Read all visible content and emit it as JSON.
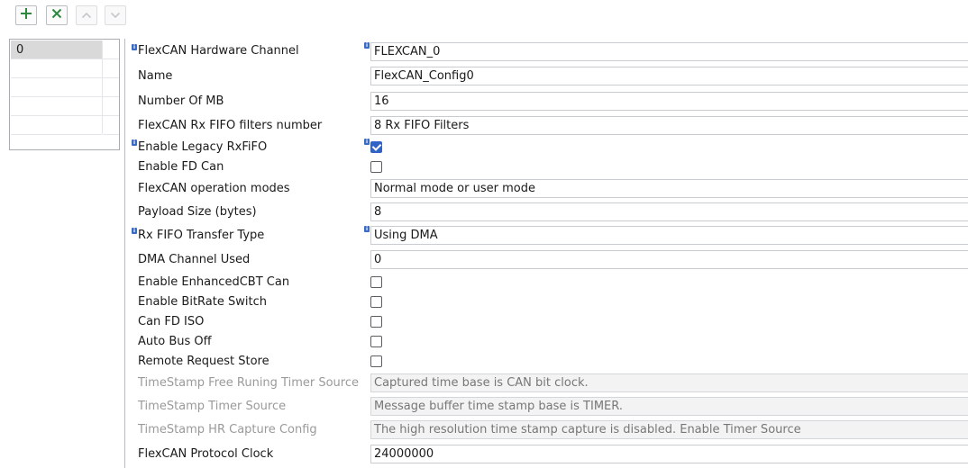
{
  "toolbar": {
    "add_icon": "plus-icon",
    "remove_icon": "close-icon",
    "up_icon": "chevron-up-icon",
    "down_icon": "chevron-down-icon"
  },
  "config_list": {
    "items": [
      "0"
    ]
  },
  "properties": [
    {
      "label": "FlexCAN Hardware Channel",
      "type": "select",
      "value": "FLEXCAN_0",
      "info": true,
      "enabled": true
    },
    {
      "label": "Name",
      "type": "text",
      "value": "FlexCAN_Config0",
      "info": false,
      "enabled": true
    },
    {
      "label": "Number Of MB",
      "type": "text",
      "value": "16",
      "info": false,
      "enabled": true
    },
    {
      "label": "FlexCAN Rx FIFO filters number",
      "type": "select",
      "value": "8 Rx FIFO Filters",
      "info": false,
      "enabled": true
    },
    {
      "label": "Enable Legacy RxFiFO",
      "type": "checkbox",
      "checked": true,
      "info": true,
      "enabled": true
    },
    {
      "label": "Enable FD Can",
      "type": "checkbox",
      "checked": false,
      "info": false,
      "enabled": true
    },
    {
      "label": "FlexCAN operation modes",
      "type": "select",
      "value": "Normal mode or user mode",
      "info": false,
      "enabled": true
    },
    {
      "label": "Payload Size (bytes)",
      "type": "select",
      "value": "8",
      "info": false,
      "enabled": true
    },
    {
      "label": "Rx FIFO Transfer Type",
      "type": "select",
      "value": "Using DMA",
      "info": true,
      "enabled": true
    },
    {
      "label": "DMA Channel Used",
      "type": "text",
      "value": "0",
      "info": false,
      "enabled": true
    },
    {
      "label": "Enable EnhancedCBT Can",
      "type": "checkbox",
      "checked": false,
      "info": false,
      "enabled": true
    },
    {
      "label": "Enable BitRate Switch",
      "type": "checkbox",
      "checked": false,
      "info": false,
      "enabled": true
    },
    {
      "label": "Can FD ISO",
      "type": "checkbox",
      "checked": false,
      "info": false,
      "enabled": true
    },
    {
      "label": "Auto Bus Off",
      "type": "checkbox",
      "checked": false,
      "info": false,
      "enabled": true
    },
    {
      "label": "Remote Request Store",
      "type": "checkbox",
      "checked": false,
      "info": false,
      "enabled": true
    },
    {
      "label": "TimeStamp Free Runing Timer Source",
      "type": "select",
      "value": "Captured time base is CAN bit clock.",
      "info": false,
      "enabled": false
    },
    {
      "label": "TimeStamp Timer Source",
      "type": "select",
      "value": "Message buffer time stamp base is TIMER.",
      "info": false,
      "enabled": false
    },
    {
      "label": "TimeStamp HR Capture Config",
      "type": "select",
      "value": "The high resolution time stamp capture is disabled. Enable Timer Source",
      "info": false,
      "enabled": false
    },
    {
      "label": "FlexCAN Protocol Clock",
      "type": "text",
      "value": "24000000",
      "info": false,
      "enabled": true
    }
  ]
}
